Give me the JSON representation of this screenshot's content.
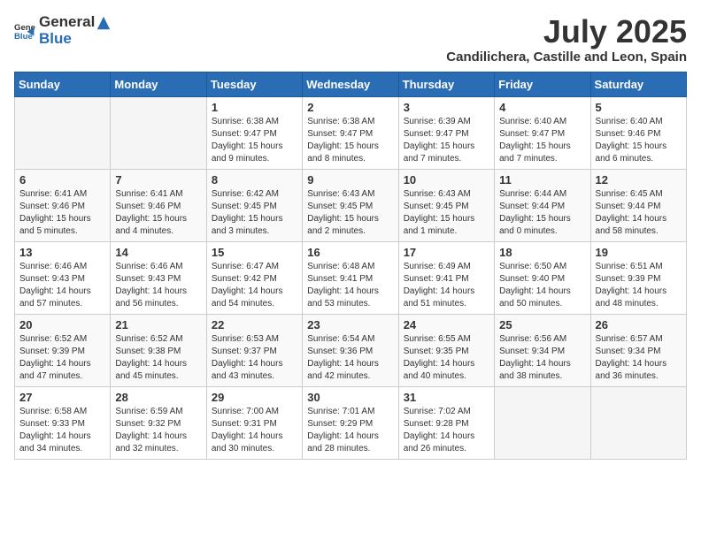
{
  "logo": {
    "general": "General",
    "blue": "Blue"
  },
  "title": "July 2025",
  "subtitle": "Candilichera, Castille and Leon, Spain",
  "weekdays": [
    "Sunday",
    "Monday",
    "Tuesday",
    "Wednesday",
    "Thursday",
    "Friday",
    "Saturday"
  ],
  "weeks": [
    [
      {
        "day": "",
        "empty": true
      },
      {
        "day": "",
        "empty": true
      },
      {
        "day": "1",
        "sunrise": "6:38 AM",
        "sunset": "9:47 PM",
        "daylight": "15 hours and 9 minutes."
      },
      {
        "day": "2",
        "sunrise": "6:38 AM",
        "sunset": "9:47 PM",
        "daylight": "15 hours and 8 minutes."
      },
      {
        "day": "3",
        "sunrise": "6:39 AM",
        "sunset": "9:47 PM",
        "daylight": "15 hours and 7 minutes."
      },
      {
        "day": "4",
        "sunrise": "6:40 AM",
        "sunset": "9:47 PM",
        "daylight": "15 hours and 7 minutes."
      },
      {
        "day": "5",
        "sunrise": "6:40 AM",
        "sunset": "9:46 PM",
        "daylight": "15 hours and 6 minutes."
      }
    ],
    [
      {
        "day": "6",
        "sunrise": "6:41 AM",
        "sunset": "9:46 PM",
        "daylight": "15 hours and 5 minutes."
      },
      {
        "day": "7",
        "sunrise": "6:41 AM",
        "sunset": "9:46 PM",
        "daylight": "15 hours and 4 minutes."
      },
      {
        "day": "8",
        "sunrise": "6:42 AM",
        "sunset": "9:45 PM",
        "daylight": "15 hours and 3 minutes."
      },
      {
        "day": "9",
        "sunrise": "6:43 AM",
        "sunset": "9:45 PM",
        "daylight": "15 hours and 2 minutes."
      },
      {
        "day": "10",
        "sunrise": "6:43 AM",
        "sunset": "9:45 PM",
        "daylight": "15 hours and 1 minute."
      },
      {
        "day": "11",
        "sunrise": "6:44 AM",
        "sunset": "9:44 PM",
        "daylight": "15 hours and 0 minutes."
      },
      {
        "day": "12",
        "sunrise": "6:45 AM",
        "sunset": "9:44 PM",
        "daylight": "14 hours and 58 minutes."
      }
    ],
    [
      {
        "day": "13",
        "sunrise": "6:46 AM",
        "sunset": "9:43 PM",
        "daylight": "14 hours and 57 minutes."
      },
      {
        "day": "14",
        "sunrise": "6:46 AM",
        "sunset": "9:43 PM",
        "daylight": "14 hours and 56 minutes."
      },
      {
        "day": "15",
        "sunrise": "6:47 AM",
        "sunset": "9:42 PM",
        "daylight": "14 hours and 54 minutes."
      },
      {
        "day": "16",
        "sunrise": "6:48 AM",
        "sunset": "9:41 PM",
        "daylight": "14 hours and 53 minutes."
      },
      {
        "day": "17",
        "sunrise": "6:49 AM",
        "sunset": "9:41 PM",
        "daylight": "14 hours and 51 minutes."
      },
      {
        "day": "18",
        "sunrise": "6:50 AM",
        "sunset": "9:40 PM",
        "daylight": "14 hours and 50 minutes."
      },
      {
        "day": "19",
        "sunrise": "6:51 AM",
        "sunset": "9:39 PM",
        "daylight": "14 hours and 48 minutes."
      }
    ],
    [
      {
        "day": "20",
        "sunrise": "6:52 AM",
        "sunset": "9:39 PM",
        "daylight": "14 hours and 47 minutes."
      },
      {
        "day": "21",
        "sunrise": "6:52 AM",
        "sunset": "9:38 PM",
        "daylight": "14 hours and 45 minutes."
      },
      {
        "day": "22",
        "sunrise": "6:53 AM",
        "sunset": "9:37 PM",
        "daylight": "14 hours and 43 minutes."
      },
      {
        "day": "23",
        "sunrise": "6:54 AM",
        "sunset": "9:36 PM",
        "daylight": "14 hours and 42 minutes."
      },
      {
        "day": "24",
        "sunrise": "6:55 AM",
        "sunset": "9:35 PM",
        "daylight": "14 hours and 40 minutes."
      },
      {
        "day": "25",
        "sunrise": "6:56 AM",
        "sunset": "9:34 PM",
        "daylight": "14 hours and 38 minutes."
      },
      {
        "day": "26",
        "sunrise": "6:57 AM",
        "sunset": "9:34 PM",
        "daylight": "14 hours and 36 minutes."
      }
    ],
    [
      {
        "day": "27",
        "sunrise": "6:58 AM",
        "sunset": "9:33 PM",
        "daylight": "14 hours and 34 minutes."
      },
      {
        "day": "28",
        "sunrise": "6:59 AM",
        "sunset": "9:32 PM",
        "daylight": "14 hours and 32 minutes."
      },
      {
        "day": "29",
        "sunrise": "7:00 AM",
        "sunset": "9:31 PM",
        "daylight": "14 hours and 30 minutes."
      },
      {
        "day": "30",
        "sunrise": "7:01 AM",
        "sunset": "9:29 PM",
        "daylight": "14 hours and 28 minutes."
      },
      {
        "day": "31",
        "sunrise": "7:02 AM",
        "sunset": "9:28 PM",
        "daylight": "14 hours and 26 minutes."
      },
      {
        "day": "",
        "empty": true
      },
      {
        "day": "",
        "empty": true
      }
    ]
  ],
  "labels": {
    "sunrise": "Sunrise:",
    "sunset": "Sunset:",
    "daylight": "Daylight:"
  }
}
